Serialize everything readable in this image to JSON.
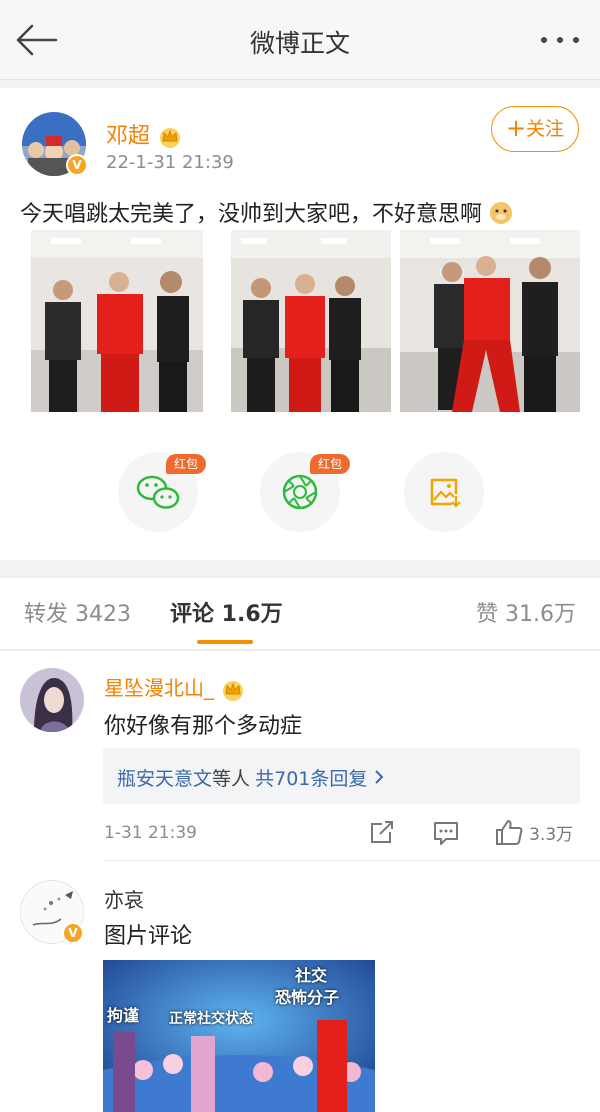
{
  "header": {
    "title": "微博正文",
    "back_icon": "arrow-left-icon",
    "more_icon": "more-dots-icon"
  },
  "post": {
    "author": "邓超",
    "time": "22-1-31 21:39",
    "follow_label": "关注",
    "text": "今天唱跳太完美了，没帅到大家吧，不好意思啊",
    "actions": [
      {
        "name": "wechat-share",
        "tag": "红包",
        "icon": "wechat-icon"
      },
      {
        "name": "moments-share",
        "tag": "红包",
        "icon": "moments-icon"
      },
      {
        "name": "save-image",
        "icon": "save-image-icon"
      }
    ],
    "colors": {
      "accent": "#f29100",
      "name": "#f28200",
      "red_tag": "#ef6b2d"
    }
  },
  "tabs": {
    "repost": "转发 3423",
    "comment": "评论 1.6万",
    "like": "赞 31.6万"
  },
  "comments": [
    {
      "name": "星坠漫北山_",
      "text": "你好像有那个多动症",
      "replies": {
        "who": "瓶安天意文",
        "mid": "等人",
        "count": "共701条回复"
      },
      "time": "1-31 21:39",
      "likes": "3.3万"
    },
    {
      "name": "亦哀",
      "text": "图片评论",
      "image_text": {
        "a": "社交",
        "b": "恐怖分子",
        "c": "拘谨",
        "d": "正常社交状态"
      }
    }
  ]
}
